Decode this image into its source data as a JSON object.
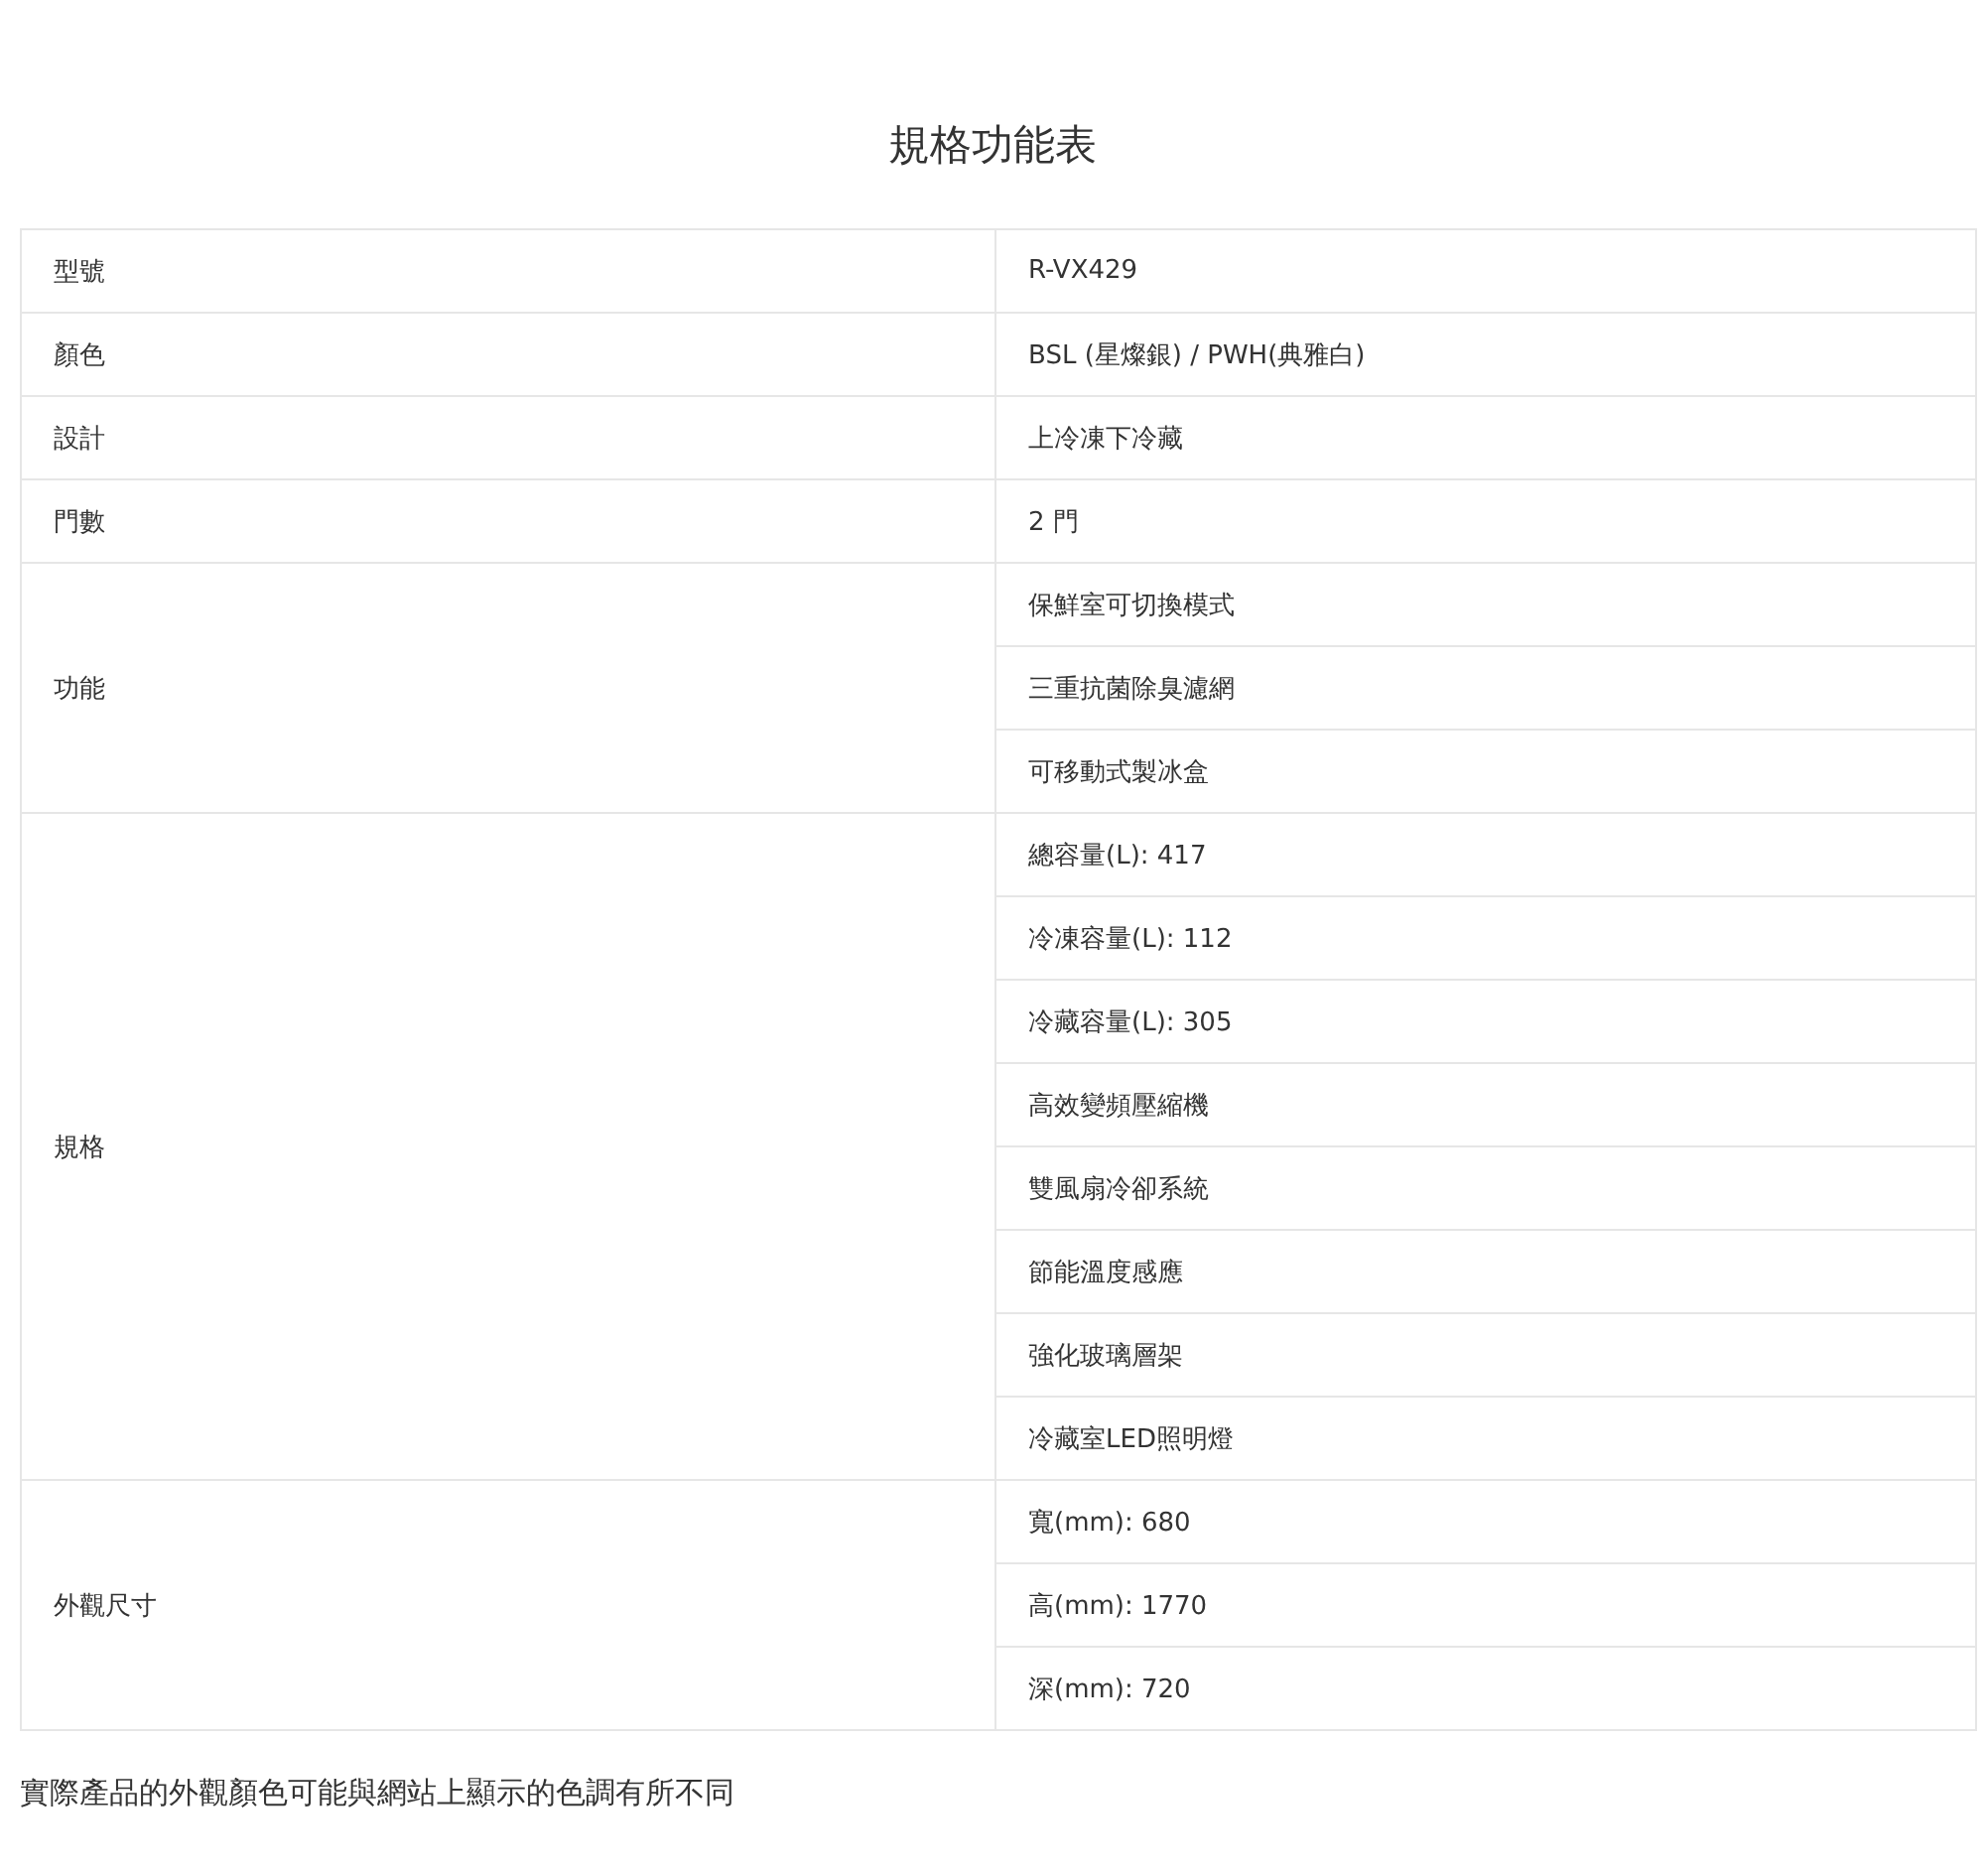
{
  "title": "規格功能表",
  "table": {
    "rows": [
      {
        "label": "型號",
        "values": [
          "R-VX429"
        ]
      },
      {
        "label": "顏色",
        "values": [
          "BSL (星燦銀) / PWH(典雅白)"
        ]
      },
      {
        "label": "設計",
        "values": [
          "上冷凍下冷藏"
        ]
      },
      {
        "label": "門數",
        "values": [
          "2 門"
        ]
      },
      {
        "label": "功能",
        "values": [
          "保鮮室可切換模式",
          "三重抗菌除臭濾網",
          "可移動式製冰盒"
        ]
      },
      {
        "label": "規格",
        "values": [
          "總容量(L): 417",
          "冷凍容量(L): 112",
          "冷藏容量(L): 305",
          "高效變頻壓縮機",
          "雙風扇冷卻系統",
          "節能溫度感應",
          "強化玻璃層架",
          "冷藏室LED照明燈"
        ]
      },
      {
        "label": "外觀尺寸",
        "values": [
          "寬(mm): 680",
          "高(mm): 1770",
          "深(mm): 720"
        ]
      }
    ]
  },
  "footnote": "實際產品的外觀顏色可能與網站上顯示的色調有所不同"
}
